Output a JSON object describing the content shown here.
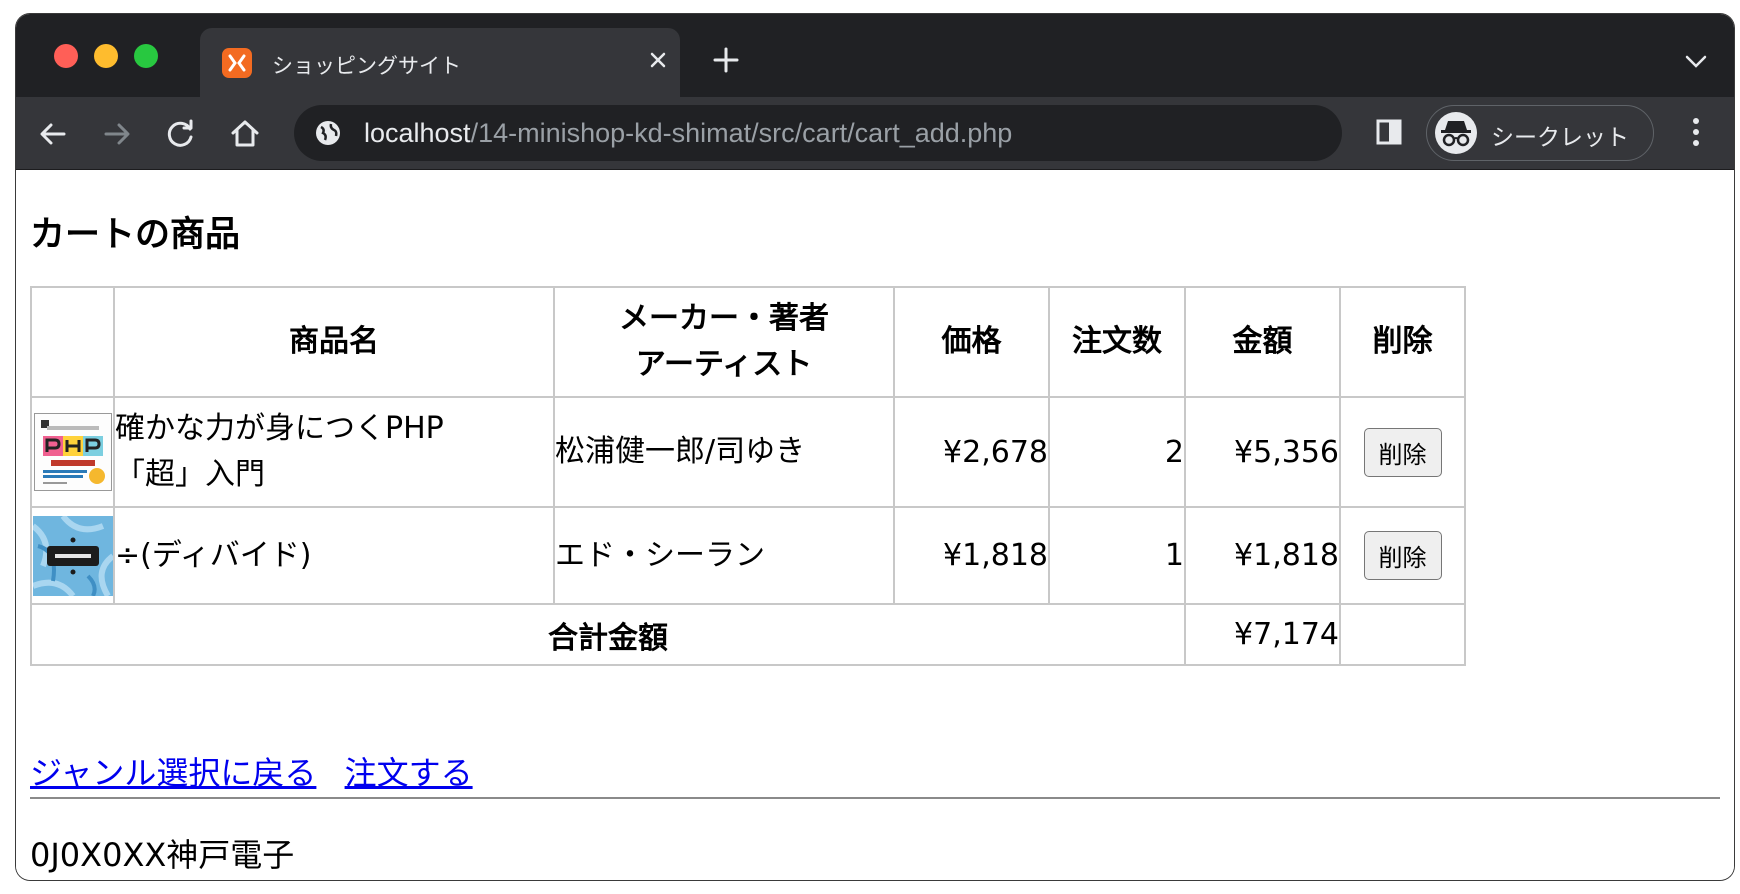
{
  "browser": {
    "tab_title": "ショッピングサイト",
    "url_host": "localhost",
    "url_path": "/14-minishop-kd-shimat/src/cart/cart_add.php",
    "incognito_label": "シークレット"
  },
  "page": {
    "heading": "カートの商品",
    "table": {
      "headers": {
        "name": "商品名",
        "maker_line1": "メーカー・著者",
        "maker_line2": "アーティスト",
        "price": "価格",
        "qty": "注文数",
        "amount": "金額",
        "delete": "削除"
      },
      "rows": [
        {
          "name_line1": "確かな力が身につくPHP",
          "name_line2": "「超」入門",
          "maker": "松浦健一郎/司ゆき",
          "price": "¥2,678",
          "qty": "2",
          "amount": "¥5,356",
          "delete_label": "削除"
        },
        {
          "name_line1": "÷(ディバイド)",
          "maker": "エド・シーラン",
          "price": "¥1,818",
          "qty": "1",
          "amount": "¥1,818",
          "delete_label": "削除"
        }
      ],
      "total_label": "合計金額",
      "total_value": "¥7,174"
    },
    "links": {
      "back": "ジャンル選択に戻る",
      "order": "注文する"
    },
    "footer": "0J0X0XX神戸電子"
  },
  "colors": {
    "tab_strip_bg": "#202124",
    "toolbar_bg": "#35363a",
    "link": "#0000ee"
  }
}
